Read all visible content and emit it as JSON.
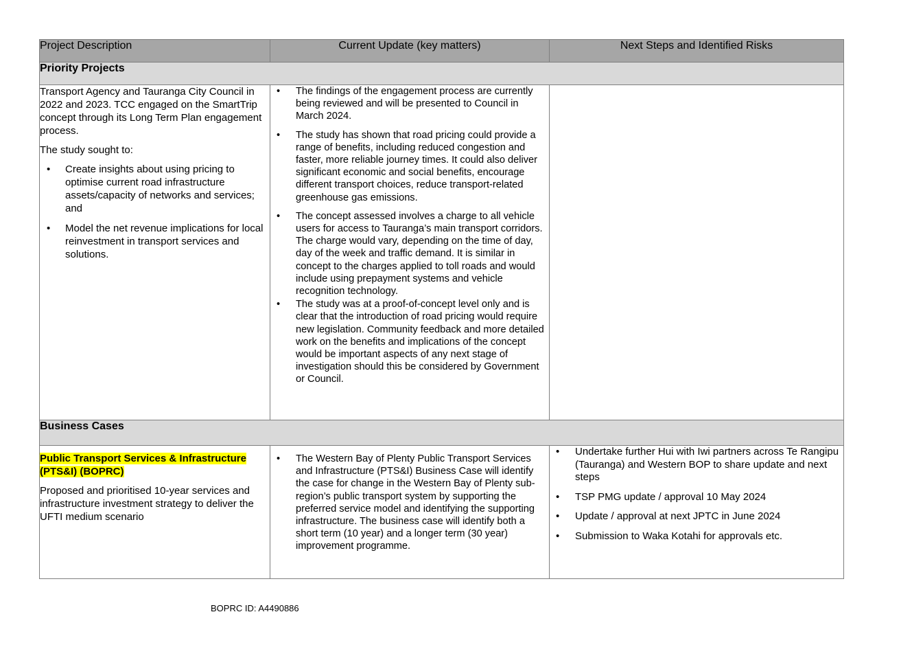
{
  "table": {
    "headers": [
      "Project Description",
      "Current Update (key matters)",
      "Next Steps and Identified Risks"
    ],
    "sections": [
      {
        "title": "Priority Projects",
        "description": {
          "paragraphs": [
            "Transport Agency and Tauranga City Council in 2022 and 2023.  TCC engaged on the SmartTrip concept through its Long Term Plan engagement process.",
            "The study sought to:"
          ],
          "bullets": [
            "Create insights about using pricing to optimise current road infrastructure assets/capacity of networks and services; and",
            "Model the net revenue implications for local reinvestment in transport services and solutions."
          ]
        },
        "update_bullets": [
          "The findings of the engagement process are currently being reviewed and will be presented to Council in March 2024.",
          "The study has shown that road pricing could provide a range of benefits, including reduced congestion and faster, more reliable journey times. It could also deliver significant economic and social benefits, encourage different transport choices, reduce transport-related greenhouse gas emissions.",
          "The concept assessed involves a charge to all vehicle users for access to Tauranga’s main transport corridors. The charge would vary, depending on the time of day, day of the week and traffic demand. It is similar in concept to the charges applied to toll roads and would include using prepayment systems and vehicle recognition technology.",
          "The study was at a proof-of-concept level only and is clear that the introduction of road pricing would require new legislation. Community feedback and more detailed work on the benefits and implications of the concept would be important aspects of any next stage of investigation should this be considered by Government or Council."
        ],
        "risk_bullets": []
      },
      {
        "title": "Business Cases",
        "description": {
          "highlight_title": "Public Transport Services & Infrastructure (PTS&I) (BOPRC)",
          "paragraphs": [
            "Proposed and prioritised 10-year services and infrastructure investment strategy to deliver the UFTI medium scenario"
          ]
        },
        "update_bullets": [
          "The Western Bay of Plenty Public Transport Services and Infrastructure (PTS&I) Business Case will identify the case for change in the Western Bay of Plenty sub-region’s public transport system by supporting the preferred service model and identifying the supporting infrastructure. The business case will identify both a short term (10 year) and a longer term (30 year) improvement programme."
        ],
        "risk_bullets": [
          "Undertake further Hui with Iwi partners across Te Rangipu (Tauranga) and Western BOP to share update and next steps",
          "TSP PMG update / approval 10 May 2024",
          "Update / approval at next JPTC in June 2024",
          "Submission to Waka Kotahi for approvals etc."
        ]
      }
    ]
  },
  "bullet_glyph": "•",
  "footer": {
    "id_text": "BOPRC ID: A4490886"
  }
}
